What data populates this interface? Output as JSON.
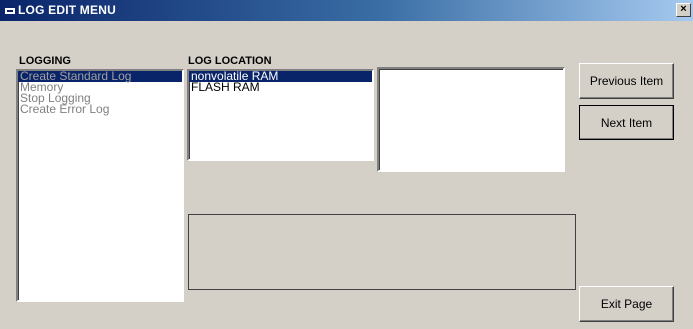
{
  "window": {
    "title": "LOG EDIT MENU",
    "close_glyph": "×"
  },
  "logging": {
    "label": "LOGGING",
    "items": [
      "Create Standard Log",
      "Memory",
      "Stop Logging",
      "Create Error Log"
    ],
    "selected_index": 0
  },
  "log_location": {
    "label": "LOG LOCATION",
    "items": [
      "nonvolatile RAM",
      "FLASH RAM"
    ],
    "selected_index": 0
  },
  "buttons": {
    "previous": "Previous Item",
    "next": "Next Item",
    "exit": "Exit Page"
  },
  "icons": {
    "title": "window-app-icon",
    "close": "close-icon"
  },
  "colors": {
    "title_start": "#0a246a",
    "title_end": "#a6caf0",
    "face": "#d4d0c8",
    "selection": "#0a246a"
  }
}
